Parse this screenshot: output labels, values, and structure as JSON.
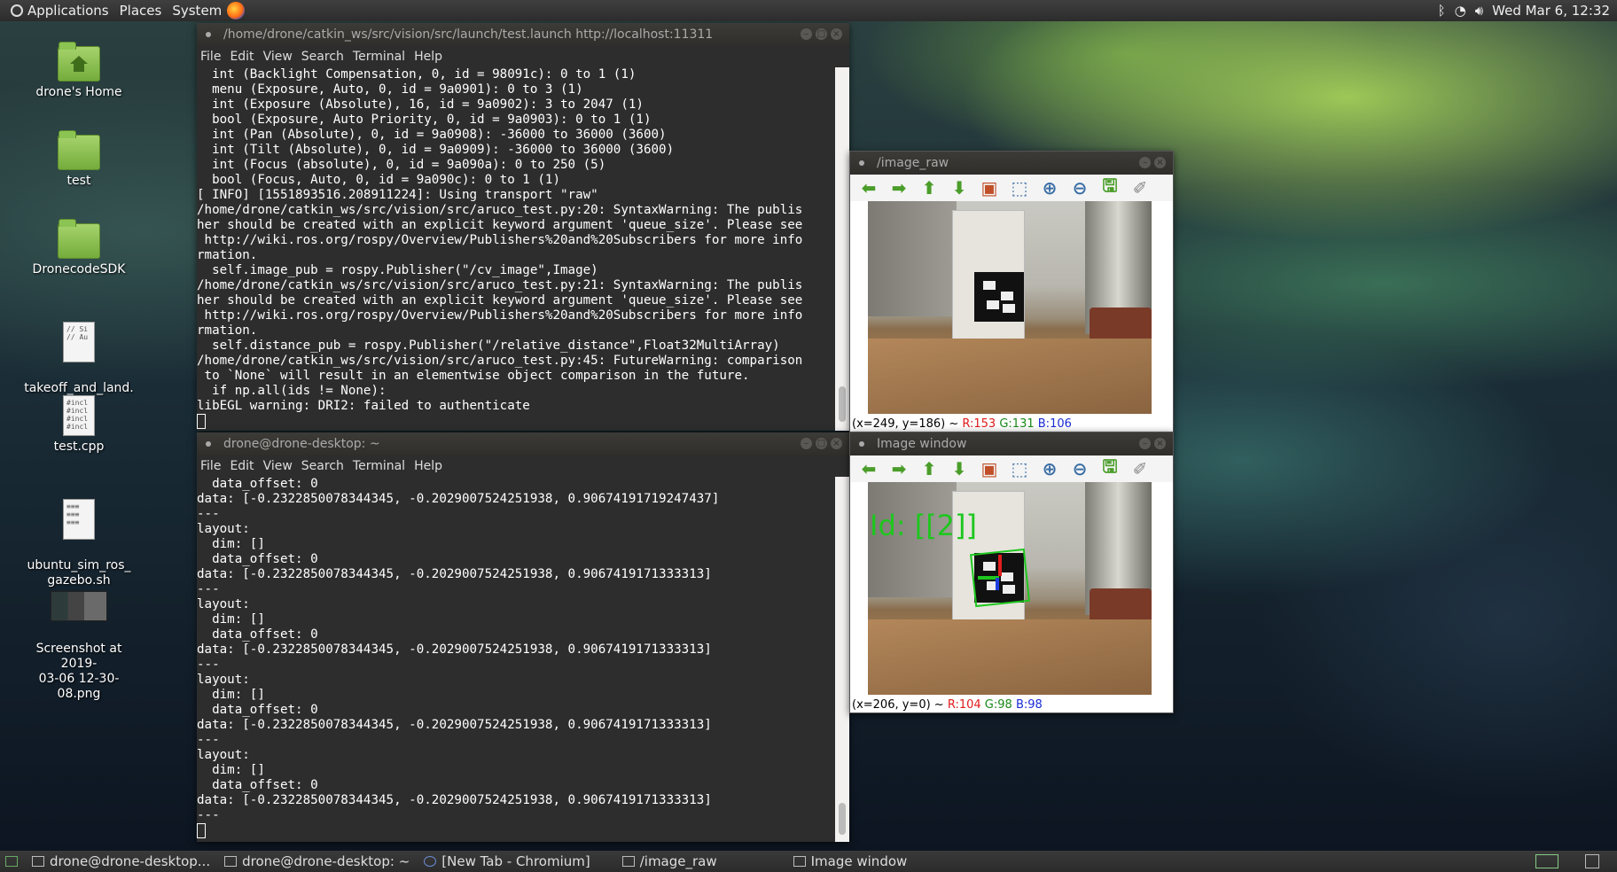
{
  "top_panel": {
    "menus": [
      "Applications",
      "Places",
      "System"
    ],
    "clock": "Wed Mar 6, 12:32"
  },
  "desktop_icons": [
    {
      "label": "drone's Home",
      "type": "home-folder"
    },
    {
      "label": "test",
      "type": "folder"
    },
    {
      "label": "DronecodeSDK",
      "type": "folder"
    },
    {
      "label": "takeoff_and_land.\ncpp",
      "type": "source-file",
      "preview": "// Si\n// Au"
    },
    {
      "label": "test.cpp",
      "type": "source-file",
      "preview": "#incl\n#incl\n#incl\n#incl"
    },
    {
      "label": "ubuntu_sim_ros_\ngazebo.sh",
      "type": "script-file"
    },
    {
      "label": "Screenshot at 2019-\n03-06 12-30-08.png",
      "type": "image-file"
    }
  ],
  "terminal_top": {
    "title": "/home/drone/catkin_ws/src/vision/src/launch/test.launch http://localhost:11311",
    "menu": [
      "File",
      "Edit",
      "View",
      "Search",
      "Terminal",
      "Help"
    ],
    "lines": [
      "  int (Backlight Compensation, 0, id = 98091c): 0 to 1 (1)",
      "  menu (Exposure, Auto, 0, id = 9a0901): 0 to 3 (1)",
      "  int (Exposure (Absolute), 16, id = 9a0902): 3 to 2047 (1)",
      "  bool (Exposure, Auto Priority, 0, id = 9a0903): 0 to 1 (1)",
      "  int (Pan (Absolute), 0, id = 9a0908): -36000 to 36000 (3600)",
      "  int (Tilt (Absolute), 0, id = 9a0909): -36000 to 36000 (3600)",
      "  int (Focus (absolute), 0, id = 9a090a): 0 to 250 (5)",
      "  bool (Focus, Auto, 0, id = 9a090c): 0 to 1 (1)",
      "[ INFO] [1551893516.208911224]: Using transport \"raw\"",
      "/home/drone/catkin_ws/src/vision/src/aruco_test.py:20: SyntaxWarning: The publis",
      "her should be created with an explicit keyword argument 'queue_size'. Please see",
      " http://wiki.ros.org/rospy/Overview/Publishers%20and%20Subscribers for more info",
      "rmation.",
      "  self.image_pub = rospy.Publisher(\"/cv_image\",Image)",
      "/home/drone/catkin_ws/src/vision/src/aruco_test.py:21: SyntaxWarning: The publis",
      "her should be created with an explicit keyword argument 'queue_size'. Please see",
      " http://wiki.ros.org/rospy/Overview/Publishers%20and%20Subscribers for more info",
      "rmation.",
      "  self.distance_pub = rospy.Publisher(\"/relative_distance\",Float32MultiArray)",
      "/home/drone/catkin_ws/src/vision/src/aruco_test.py:45: FutureWarning: comparison",
      " to `None` will result in an elementwise object comparison in the future.",
      "  if np.all(ids != None):",
      "libEGL warning: DRI2: failed to authenticate"
    ]
  },
  "terminal_bottom": {
    "title": "drone@drone-desktop: ~",
    "menu": [
      "File",
      "Edit",
      "View",
      "Search",
      "Terminal",
      "Help"
    ],
    "lines": [
      "  data_offset: 0",
      "data: [-0.2322850078344345, -0.2029007524251938, 0.90674191719247437]",
      "---",
      "layout:",
      "  dim: []",
      "  data_offset: 0",
      "data: [-0.2322850078344345, -0.2029007524251938, 0.9067419171333313]",
      "---",
      "layout:",
      "  dim: []",
      "  data_offset: 0",
      "data: [-0.2322850078344345, -0.2029007524251938, 0.9067419171333313]",
      "---",
      "layout:",
      "  dim: []",
      "  data_offset: 0",
      "data: [-0.2322850078344345, -0.2029007524251938, 0.9067419171333313]",
      "---",
      "layout:",
      "  dim: []",
      "  data_offset: 0",
      "data: [-0.2322850078344345, -0.2029007524251938, 0.9067419171333313]",
      "---"
    ]
  },
  "image_raw_window": {
    "title": "/image_raw",
    "status_prefix": "(x=249, y=186) ~ ",
    "r": "R:153",
    "g": "G:131",
    "b": "B:106"
  },
  "image_window": {
    "title": "Image window",
    "overlay_text": "Id: [[2]]",
    "status_prefix": "(x=206, y=0) ~ ",
    "r": "R:104",
    "g": "G:98",
    "b": "B:98"
  },
  "toolbar_icons": [
    "arrow-left-icon",
    "arrow-right-icon",
    "arrow-up-icon",
    "arrow-down-icon",
    "image-icon",
    "zoom-fit-icon",
    "zoom-in-icon",
    "zoom-out-icon",
    "save-icon",
    "clear-icon"
  ],
  "taskbar": {
    "items": [
      "drone@drone-desktop...",
      "drone@drone-desktop: ~",
      "[New Tab - Chromium]",
      "/image_raw",
      "Image window"
    ]
  },
  "colors": {
    "status_r": "#e01b1b",
    "status_g": "#1a8a1a",
    "status_b": "#1a2bd6",
    "overlay_green": "#1ec71e"
  }
}
